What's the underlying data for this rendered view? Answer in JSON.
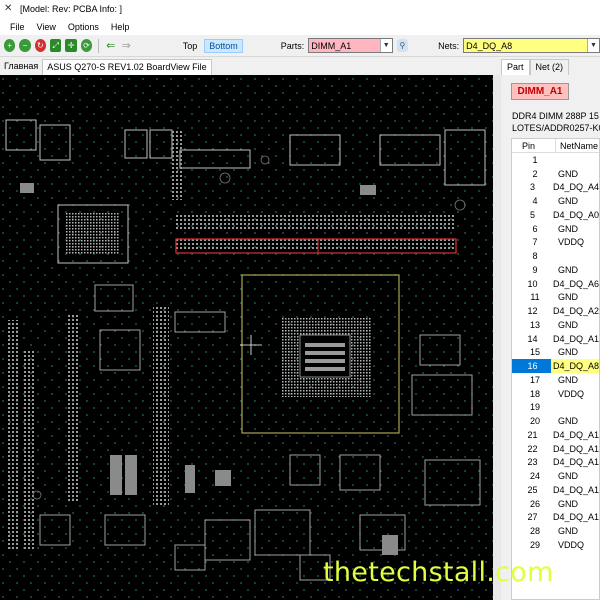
{
  "window": {
    "title": "[Model: Rev:  PCBA Info: ]"
  },
  "menu": [
    "File",
    "View",
    "Options",
    "Help"
  ],
  "toolbar": {
    "layer_top": "Top",
    "layer_bottom": "Bottom",
    "parts_label": "Parts:",
    "parts_value": "DIMM_A1",
    "nets_label": "Nets:",
    "nets_value": "D4_DQ_A8",
    "colors": {
      "parts_bg": "#ffb6c1",
      "nets_bg": "#ffff80",
      "active_layer": "#cce8ff"
    }
  },
  "tabs": {
    "home": "Главная",
    "file": "ASUS Q270-S REV1.02 BoardView File"
  },
  "side": {
    "tab_part": "Part",
    "tab_net": "Net (2)",
    "part_name": "DIMM_A1",
    "desc_line1": "DDR4 DIMM 288P 15",
    "desc_line2": "LOTES/ADDR0257-K0",
    "col_pin": "Pin",
    "col_netname": "NetName",
    "rows": [
      {
        "pin": "1",
        "net": ""
      },
      {
        "pin": "2",
        "net": "GND"
      },
      {
        "pin": "3",
        "net": "D4_DQ_A4"
      },
      {
        "pin": "4",
        "net": "GND"
      },
      {
        "pin": "5",
        "net": "D4_DQ_A0"
      },
      {
        "pin": "6",
        "net": "GND"
      },
      {
        "pin": "7",
        "net": "VDDQ"
      },
      {
        "pin": "8",
        "net": ""
      },
      {
        "pin": "9",
        "net": "GND"
      },
      {
        "pin": "10",
        "net": "D4_DQ_A6"
      },
      {
        "pin": "11",
        "net": "GND"
      },
      {
        "pin": "12",
        "net": "D4_DQ_A2"
      },
      {
        "pin": "13",
        "net": "GND"
      },
      {
        "pin": "14",
        "net": "D4_DQ_A1"
      },
      {
        "pin": "15",
        "net": "GND"
      },
      {
        "pin": "16",
        "net": "D4_DQ_A8"
      },
      {
        "pin": "17",
        "net": "GND"
      },
      {
        "pin": "18",
        "net": "VDDQ"
      },
      {
        "pin": "19",
        "net": ""
      },
      {
        "pin": "20",
        "net": "GND"
      },
      {
        "pin": "21",
        "net": "D4_DQ_A1"
      },
      {
        "pin": "22",
        "net": "D4_DQ_A1"
      },
      {
        "pin": "23",
        "net": "D4_DQ_A1"
      },
      {
        "pin": "24",
        "net": "GND"
      },
      {
        "pin": "25",
        "net": "D4_DQ_A1"
      },
      {
        "pin": "26",
        "net": "GND"
      },
      {
        "pin": "27",
        "net": "D4_DQ_A1"
      },
      {
        "pin": "28",
        "net": "GND"
      },
      {
        "pin": "29",
        "net": "VDDQ"
      }
    ],
    "selected_pin": "16"
  },
  "watermark": "thetechstall.com"
}
